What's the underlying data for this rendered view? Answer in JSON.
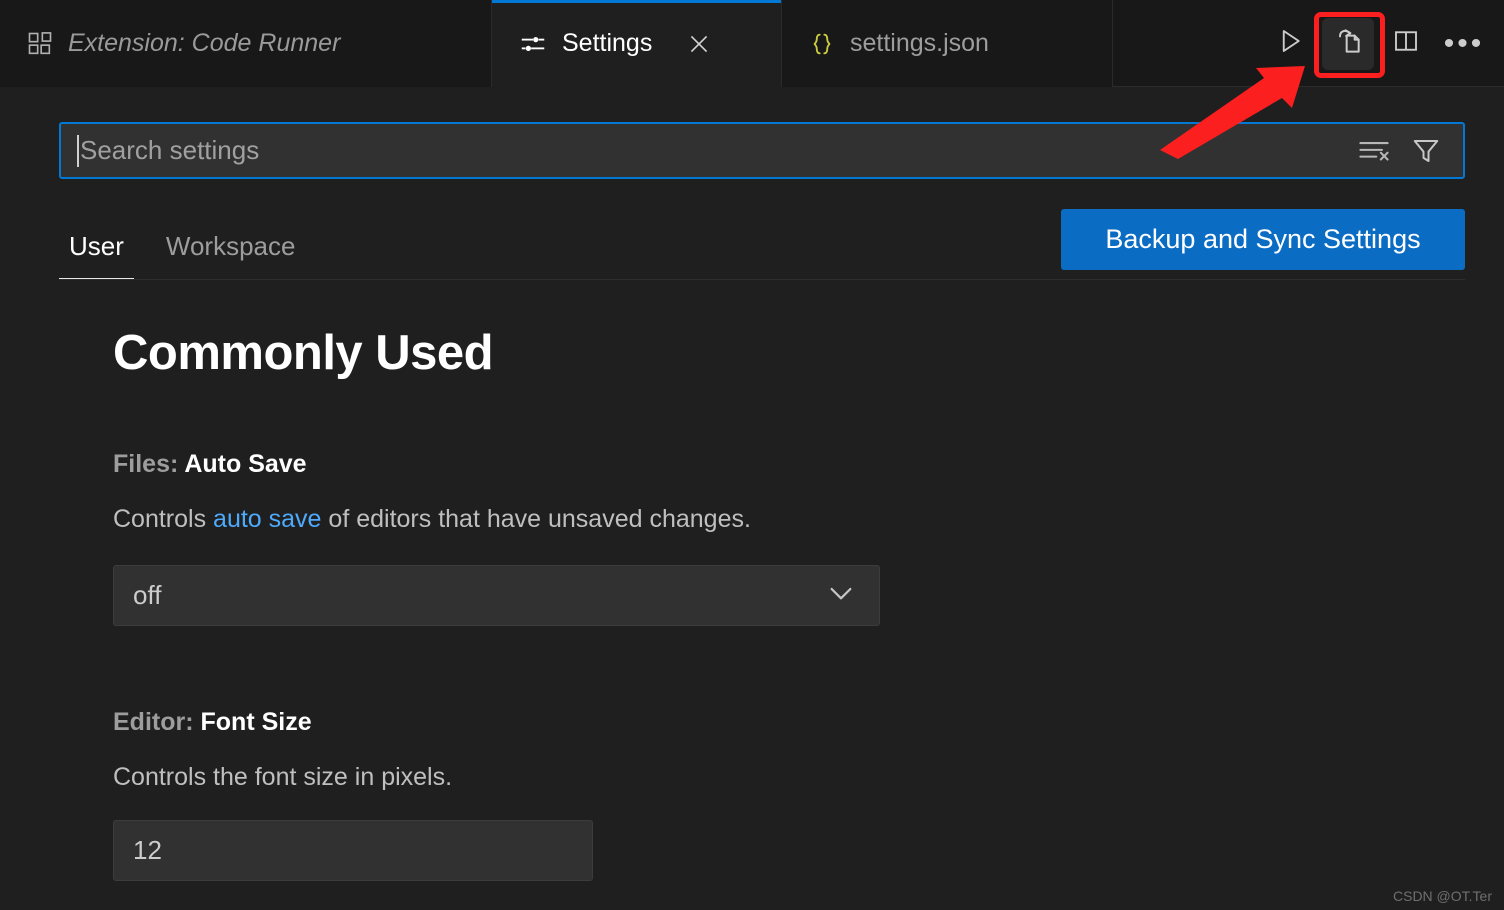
{
  "window": {
    "background": "#1f1f1f",
    "accent_blue": "#0078d4",
    "annotation_red": "#fb1f1f"
  },
  "tabbar": {
    "tabs": [
      {
        "label": "Extension: Code Runner",
        "icon": "extensions-icon",
        "state": "preview"
      },
      {
        "label": "Settings",
        "icon": "settings-sliders-icon",
        "state": "active",
        "close_label": "×"
      },
      {
        "label": "settings.json",
        "icon": "json-braces-icon",
        "state": "inactive"
      }
    ],
    "toolbar": [
      {
        "name": "run-code-button",
        "icon": "play-icon",
        "label": "Run Code"
      },
      {
        "name": "open-settings-json-button",
        "icon": "open-file-arrow-icon",
        "label": "Open Settings (JSON)",
        "highlighted": true
      },
      {
        "name": "split-editor-button",
        "icon": "split-editor-icon",
        "label": "Split Editor"
      },
      {
        "name": "more-actions-button",
        "icon": "ellipsis-icon",
        "label": "•••"
      }
    ]
  },
  "search": {
    "placeholder": "Search settings",
    "value": "",
    "clear_label": "Clear Settings Search Results",
    "filter_label": "Filter Settings"
  },
  "scope": {
    "tabs": [
      {
        "label": "User",
        "active": true
      },
      {
        "label": "Workspace",
        "active": false
      }
    ],
    "sync_button": "Backup and Sync Settings"
  },
  "main": {
    "section_title": "Commonly Used",
    "settings": [
      {
        "prefix": "Files: ",
        "name": "Auto Save",
        "desc_before": "Controls ",
        "desc_link": "auto save",
        "desc_after": " of editors that have unsaved changes.",
        "control": "select",
        "value": "off"
      },
      {
        "prefix": "Editor: ",
        "name": "Font Size",
        "desc_before": "Controls the font size in pixels.",
        "desc_link": "",
        "desc_after": "",
        "control": "input",
        "value": "12"
      }
    ]
  },
  "watermark": "CSDN @OT.Ter"
}
